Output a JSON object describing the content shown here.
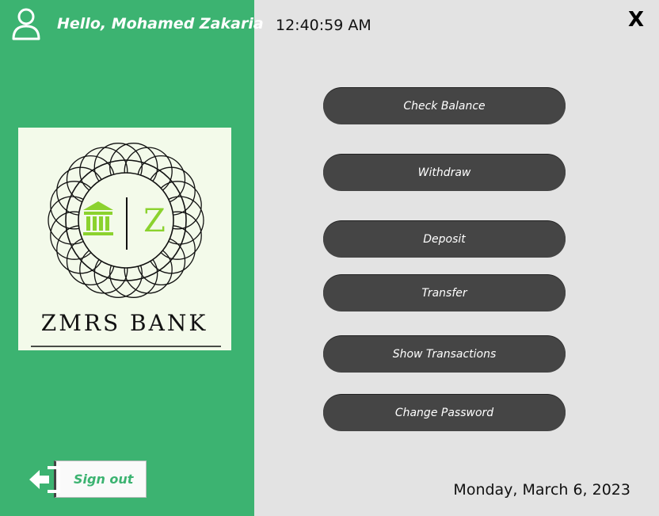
{
  "sidebar": {
    "greeting": "Hello, Mohamed Zakaria",
    "logo": {
      "bank_name": "ZMRS BANK",
      "monogram": "Z"
    },
    "signout_label": "Sign out"
  },
  "header": {
    "clock": "12:40:59 AM",
    "close_label": "X"
  },
  "menu": {
    "items": [
      {
        "label": "Check Balance"
      },
      {
        "label": "Withdraw"
      },
      {
        "label": "Deposit"
      },
      {
        "label": "Transfer"
      },
      {
        "label": "Show Transactions"
      },
      {
        "label": "Change Password"
      }
    ]
  },
  "footer": {
    "date": "Monday, March 6, 2023"
  },
  "colors": {
    "sidebar_green": "#3cb371",
    "button_dark": "#454545",
    "background": "#e3e3e3",
    "logo_accent": "#8bd22e"
  },
  "icons": {
    "user": "user-icon",
    "signout": "signout-arrow-icon",
    "bank": "bank-icon"
  }
}
